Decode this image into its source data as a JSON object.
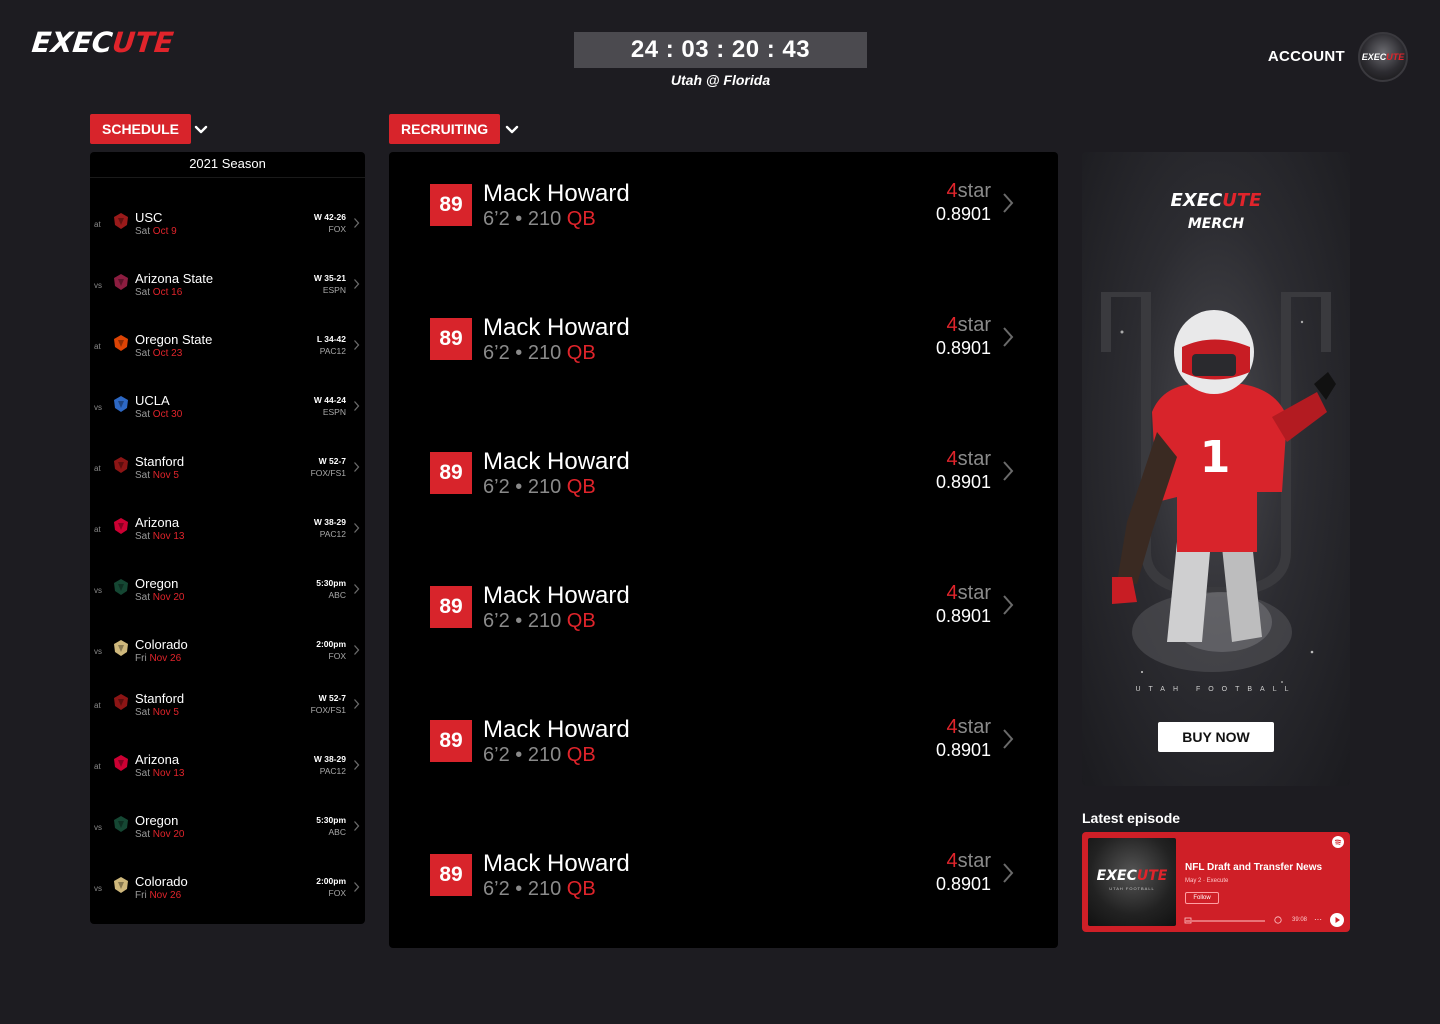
{
  "header": {
    "logo_part1": "EXEC",
    "logo_part2": "UTE",
    "countdown": "24 : 03 : 20 : 43",
    "matchup": "Utah @ Florida",
    "account_label": "ACCOUNT",
    "avatar_part1": "EXEC",
    "avatar_part2": "UTE"
  },
  "schedule": {
    "tab_label": "SCHEDULE",
    "season": "2021 Season",
    "games": [
      {
        "ha": "at",
        "team": "USC",
        "day": "Sat",
        "date": "Oct 9",
        "result": "W 42-26",
        "network": "FOX",
        "logo": "usc-icon"
      },
      {
        "ha": "vs",
        "team": "Arizona State",
        "day": "Sat",
        "date": "Oct 16",
        "result": "W 35-21",
        "network": "ESPN",
        "logo": "arizona-state-icon"
      },
      {
        "ha": "at",
        "team": "Oregon State",
        "day": "Sat",
        "date": "Oct 23",
        "result": "L 34-42",
        "network": "PAC12",
        "logo": "oregon-state-icon"
      },
      {
        "ha": "vs",
        "team": "UCLA",
        "day": "Sat",
        "date": "Oct 30",
        "result": "W 44-24",
        "network": "ESPN",
        "logo": "ucla-icon"
      },
      {
        "ha": "at",
        "team": "Stanford",
        "day": "Sat",
        "date": "Nov 5",
        "result": "W 52-7",
        "network": "FOX/FS1",
        "logo": "stanford-icon"
      },
      {
        "ha": "at",
        "team": "Arizona",
        "day": "Sat",
        "date": "Nov 13",
        "result": "W 38-29",
        "network": "PAC12",
        "logo": "arizona-icon"
      },
      {
        "ha": "vs",
        "team": "Oregon",
        "day": "Sat",
        "date": "Nov 20",
        "result": "5:30pm",
        "network": "ABC",
        "logo": "oregon-icon"
      },
      {
        "ha": "vs",
        "team": "Colorado",
        "day": "Fri",
        "date": "Nov 26",
        "result": "2:00pm",
        "network": "FOX",
        "logo": "colorado-icon"
      },
      {
        "ha": "at",
        "team": "Stanford",
        "day": "Sat",
        "date": "Nov 5",
        "result": "W 52-7",
        "network": "FOX/FS1",
        "logo": "stanford-icon"
      },
      {
        "ha": "at",
        "team": "Arizona",
        "day": "Sat",
        "date": "Nov 13",
        "result": "W 38-29",
        "network": "PAC12",
        "logo": "arizona-icon"
      },
      {
        "ha": "vs",
        "team": "Oregon",
        "day": "Sat",
        "date": "Nov 20",
        "result": "5:30pm",
        "network": "ABC",
        "logo": "oregon-icon"
      },
      {
        "ha": "vs",
        "team": "Colorado",
        "day": "Fri",
        "date": "Nov 26",
        "result": "2:00pm",
        "network": "FOX",
        "logo": "colorado-icon"
      }
    ]
  },
  "recruiting": {
    "tab_label": "RECRUITING",
    "recruits": [
      {
        "score": "89",
        "name": "Mack Howard",
        "height": "6’2",
        "weight": "210",
        "position": "QB",
        "stars": "4",
        "star_label": "star",
        "rating": "0.8901"
      },
      {
        "score": "89",
        "name": "Mack Howard",
        "height": "6’2",
        "weight": "210",
        "position": "QB",
        "stars": "4",
        "star_label": "star",
        "rating": "0.8901"
      },
      {
        "score": "89",
        "name": "Mack Howard",
        "height": "6’2",
        "weight": "210",
        "position": "QB",
        "stars": "4",
        "star_label": "star",
        "rating": "0.8901"
      },
      {
        "score": "89",
        "name": "Mack Howard",
        "height": "6’2",
        "weight": "210",
        "position": "QB",
        "stars": "4",
        "star_label": "star",
        "rating": "0.8901"
      },
      {
        "score": "89",
        "name": "Mack Howard",
        "height": "6’2",
        "weight": "210",
        "position": "QB",
        "stars": "4",
        "star_label": "star",
        "rating": "0.8901"
      },
      {
        "score": "89",
        "name": "Mack Howard",
        "height": "6’2",
        "weight": "210",
        "position": "QB",
        "stars": "4",
        "star_label": "star",
        "rating": "0.8901"
      }
    ]
  },
  "merch": {
    "title_part1": "EXEC",
    "title_part2": "UTE",
    "subtitle": "MERCH",
    "tagline": "UTAH FOOTBALL",
    "button": "BUY NOW"
  },
  "episode": {
    "label": "Latest episode",
    "thumb_part1": "EXEC",
    "thumb_part2": "UTE",
    "thumb_sub": "UTAH FOOTBALL",
    "title": "NFL Draft and Transfer News",
    "subtitle": "May 2 · Execute",
    "follow": "Follow",
    "duration": "39:08",
    "more": "···"
  },
  "colors": {
    "background": "#1d1c21",
    "panel": "#000000",
    "accent": "#d8242b",
    "muted": "#8a8a8a"
  }
}
